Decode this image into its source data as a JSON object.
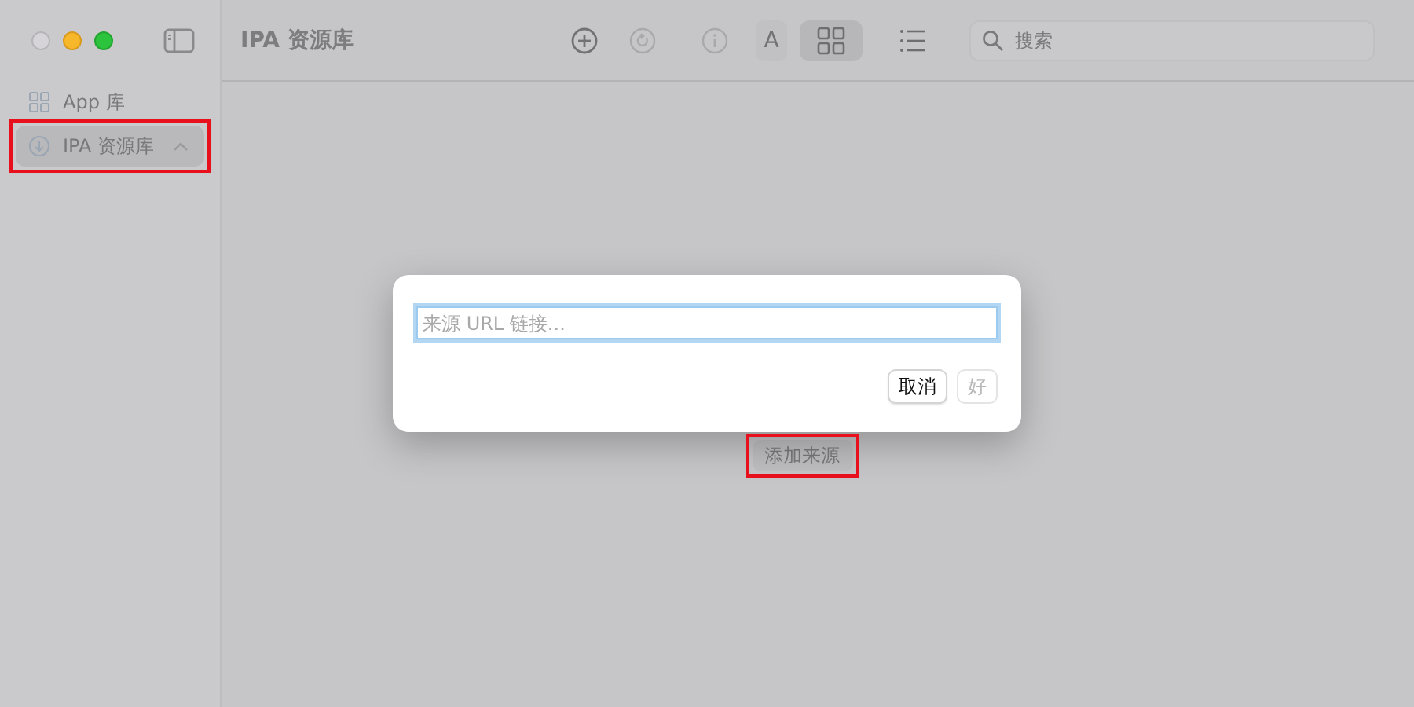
{
  "window": {
    "title": "IPA 资源库"
  },
  "sidebar": {
    "items": [
      {
        "label": "App 库",
        "selected": false,
        "highlighted": false
      },
      {
        "label": "IPA 资源库",
        "selected": true,
        "expanded": true,
        "highlighted": true
      }
    ]
  },
  "toolbar": {
    "buttons": [
      {
        "kind": "add",
        "disabled": false
      },
      {
        "kind": "refresh",
        "disabled": true
      },
      {
        "kind": "info",
        "disabled": true
      },
      {
        "kind": "text",
        "label": "A",
        "disabled": false
      }
    ],
    "views": [
      {
        "kind": "grid",
        "selected": true
      },
      {
        "kind": "list",
        "selected": false
      }
    ]
  },
  "search": {
    "placeholder": "搜索"
  },
  "content": {
    "button": {
      "label": "添加来源",
      "highlighted": true
    }
  },
  "dialog": {
    "input": {
      "placeholder": "来源 URL 链接..."
    },
    "buttons": [
      {
        "label": "取消",
        "disabled": false
      },
      {
        "label": "好",
        "disabled": true
      }
    ]
  }
}
